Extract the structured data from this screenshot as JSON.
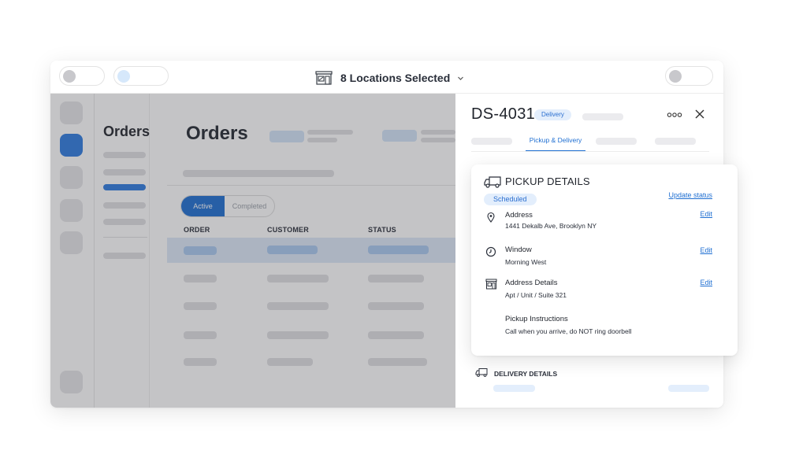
{
  "topbar": {
    "location_label": "8 Locations Selected"
  },
  "app": {
    "subnav_title": "Orders",
    "page_title": "Orders",
    "filter_active": "Active",
    "filter_completed": "Completed",
    "columns": [
      "ORDER",
      "CUSTOMER",
      "STATUS"
    ]
  },
  "drawer": {
    "order_id": "DS-4031",
    "type_badge": "Delivery",
    "active_tab": "Pickup & Delivery"
  },
  "pickup": {
    "title": "PICKUP DETAILS",
    "status": "Scheduled",
    "update_link": "Update status",
    "edit_label": "Edit",
    "fields": [
      {
        "label": "Address",
        "value": "1441 Dekalb Ave, Brooklyn NY",
        "icon": "map-pin-icon"
      },
      {
        "label": "Window",
        "value": "Morning West",
        "icon": "clock-icon"
      },
      {
        "label": "Address Details",
        "value": "Apt / Unit / Suite 321",
        "icon": "building-icon"
      },
      {
        "label": "Pickup Instructions",
        "value": "Call when you arrive, do NOT ring doorbell",
        "icon": ""
      }
    ]
  },
  "delivery": {
    "title": "DELIVERY DETAILS"
  },
  "colors": {
    "accent": "#1f6fd2",
    "badge_bg": "#e3eefc"
  }
}
